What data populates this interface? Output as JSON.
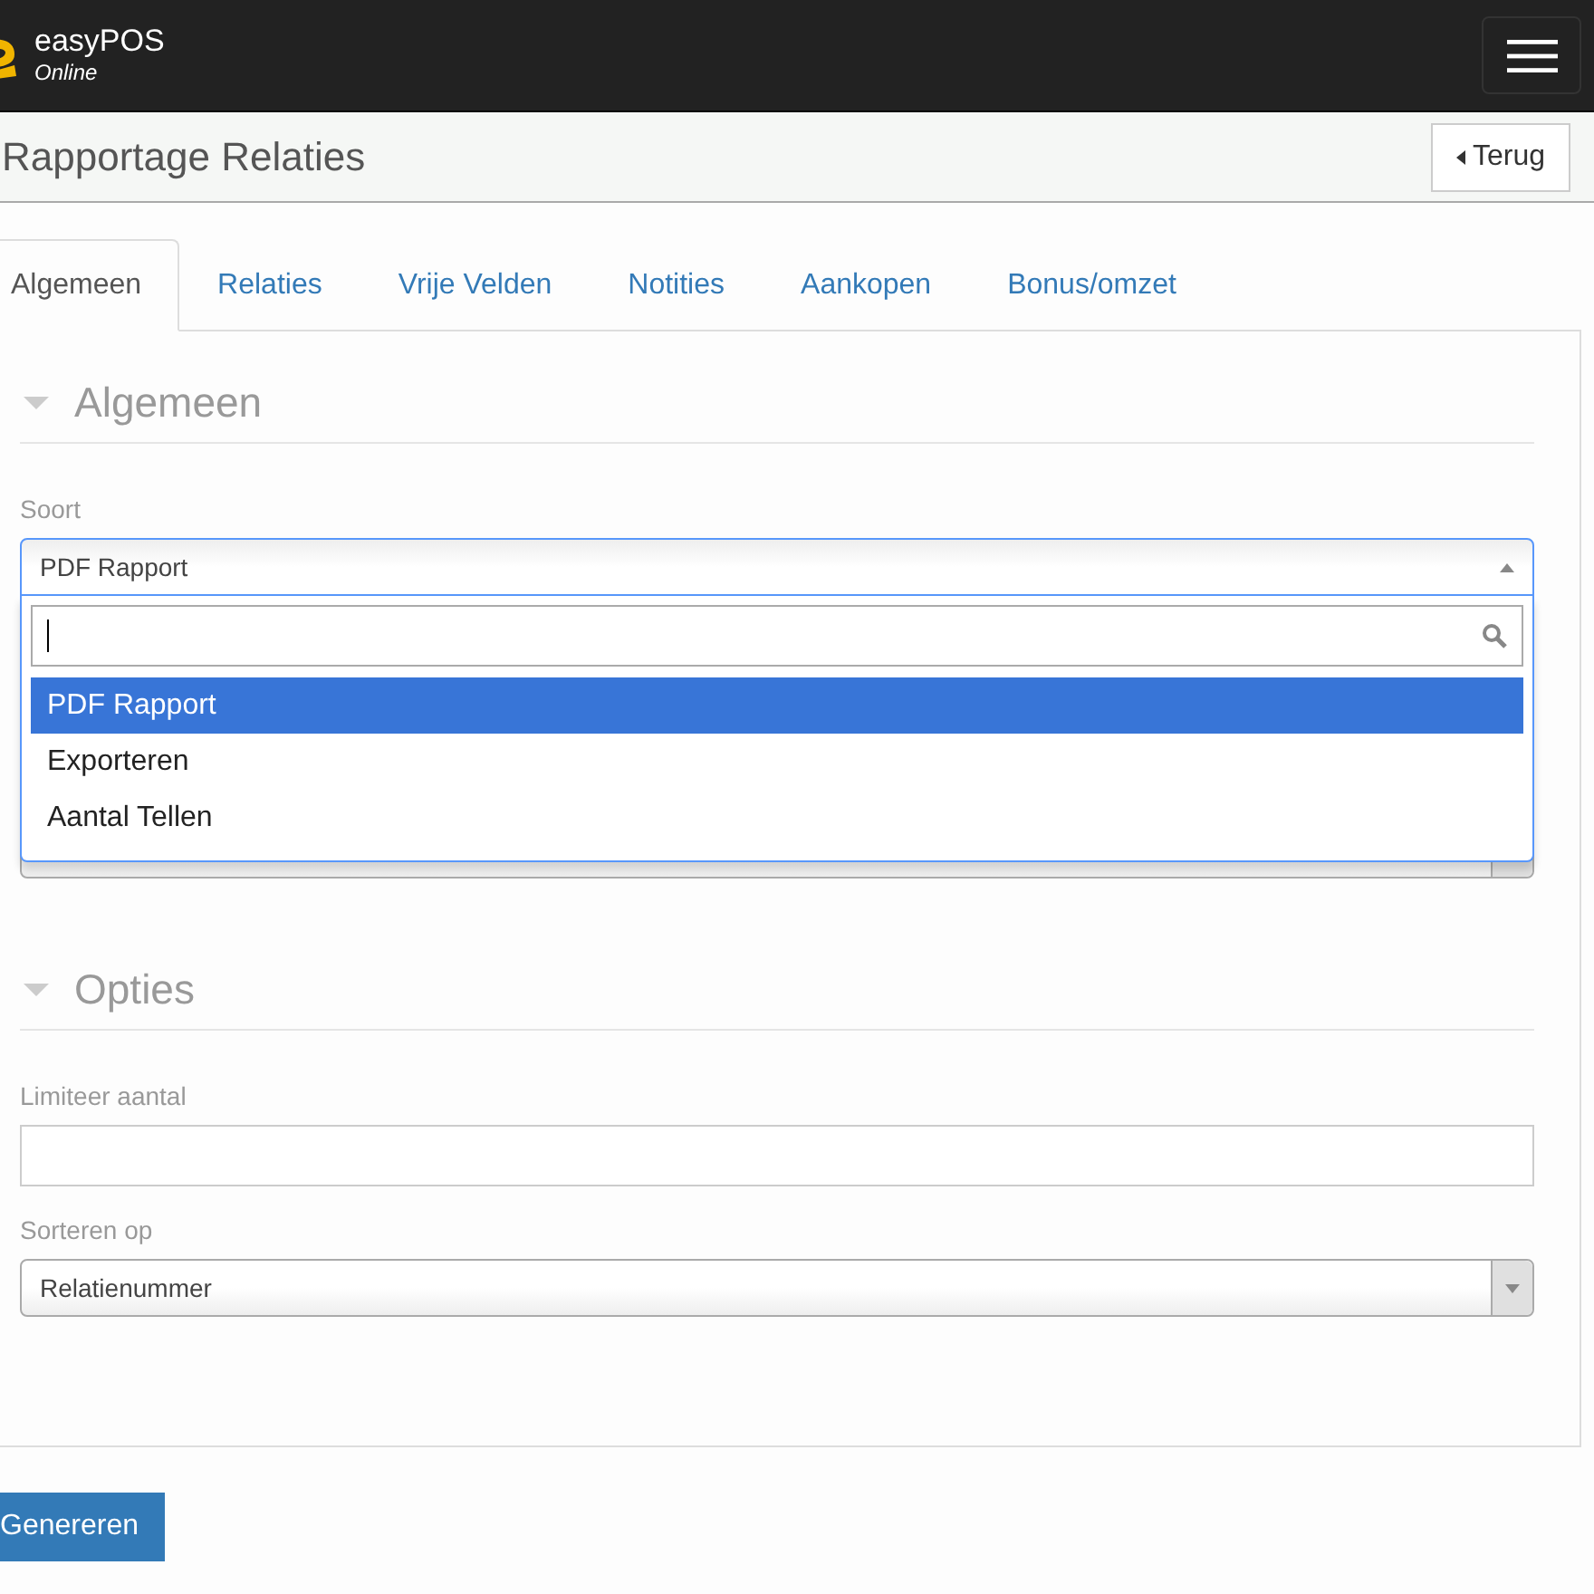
{
  "header": {
    "brand": "easyPOS",
    "subtitle": "Online"
  },
  "page": {
    "title": "Rapportage Relaties",
    "back_button": "Terug"
  },
  "tabs": [
    {
      "label": "Algemeen",
      "selected": true
    },
    {
      "label": "Relaties",
      "selected": false
    },
    {
      "label": "Vrije Velden",
      "selected": false
    },
    {
      "label": "Notities",
      "selected": false
    },
    {
      "label": "Aankopen",
      "selected": false
    },
    {
      "label": "Bonus/omzet",
      "selected": false
    }
  ],
  "sections": [
    {
      "title": "Algemeen",
      "expanded": true,
      "fields": [
        {
          "kind": "select",
          "label": "Soort",
          "value": "PDF Rapport",
          "open": true,
          "options": [
            {
              "label": "PDF Rapport",
              "selected": true
            },
            {
              "label": "Exporteren",
              "selected": false
            },
            {
              "label": "Aantal Tellen",
              "selected": false
            }
          ]
        },
        {
          "kind": "select",
          "open": false
        }
      ]
    },
    {
      "title": "Opties",
      "expanded": true,
      "fields": [
        {
          "kind": "input",
          "label": "Limiteer aantal"
        },
        {
          "kind": "select",
          "label": "Sorteren op",
          "value": "Relatienummer",
          "open": false
        }
      ]
    }
  ],
  "submit_button": "Genereren"
}
